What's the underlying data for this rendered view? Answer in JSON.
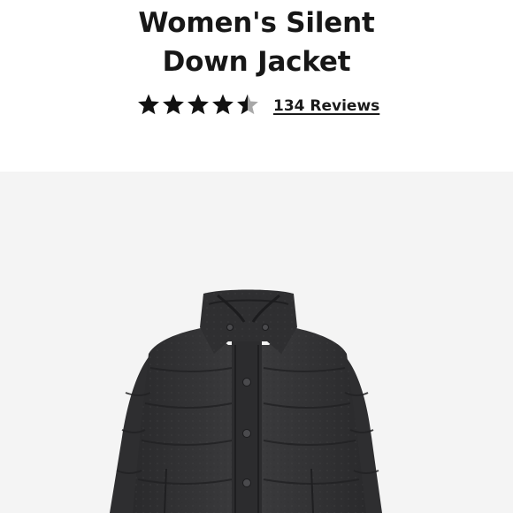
{
  "product": {
    "title_line1": "Women's Silent",
    "title_line2": "Down Jacket",
    "rating": 4.5,
    "rating_max": 5,
    "reviews_label": "134 Reviews",
    "image_icon": "jacket-photo"
  },
  "colors": {
    "text": "#171717",
    "star_filled": "#111111",
    "star_empty": "#a8a8a8",
    "image_background": "#f4f4f4",
    "jacket": "#38383a"
  }
}
